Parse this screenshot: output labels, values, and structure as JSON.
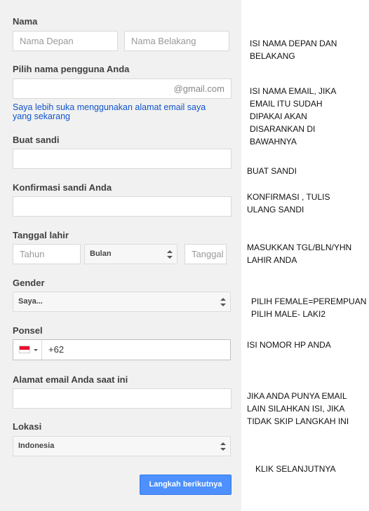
{
  "form": {
    "name_label": "Nama",
    "first_name_placeholder": "Nama Depan",
    "last_name_placeholder": "Nama Belakang",
    "username_label": "Pilih nama pengguna Anda",
    "username_suffix": "@gmail.com",
    "use_current_email_link": "Saya lebih suka menggunakan alamat email saya yang sekarang",
    "password_label": "Buat sandi",
    "confirm_password_label": "Konfirmasi sandi Anda",
    "birthdate_label": "Tanggal lahir",
    "year_placeholder": "Tahun",
    "month_value": "Bulan",
    "day_placeholder": "Tanggal",
    "gender_label": "Gender",
    "gender_value": "Saya...",
    "phone_label": "Ponsel",
    "phone_value": "+62",
    "phone_country_flag": "indonesia-flag-icon",
    "current_email_label": "Alamat email Anda saat ini",
    "location_label": "Lokasi",
    "location_value": "Indonesia",
    "next_button": "Langkah berikutnya"
  },
  "notes": {
    "name": "ISI NAMA DEPAN DAN BELAKANG",
    "username": "ISI NAMA EMAIL, JIKA EMAIL ITU SUDAH DIPAKAI AKAN DISARANKAN DI BAWAHNYA",
    "password": "BUAT SANDI",
    "confirm": "KONFIRMASI , TULIS ULANG SANDI",
    "birthdate": "MASUKKAN TGL/BLN/YHN LAHIR ANDA",
    "gender_line1": "PILIH FEMALE=PEREMPUAN",
    "gender_line2": "PILIH MALE- LAKI2",
    "phone": "ISI NOMOR HP ANDA",
    "current_email": "JIKA ANDA PUNYA EMAIL LAIN SILAHKAN ISI, JIKA TIDAK SKIP LANGKAH INI",
    "next": "KLIK SELANJUTNYA"
  },
  "colors": {
    "panel_bg": "#f1f1f1",
    "button_blue": "#4d90fe",
    "link_blue": "#1155cc"
  }
}
